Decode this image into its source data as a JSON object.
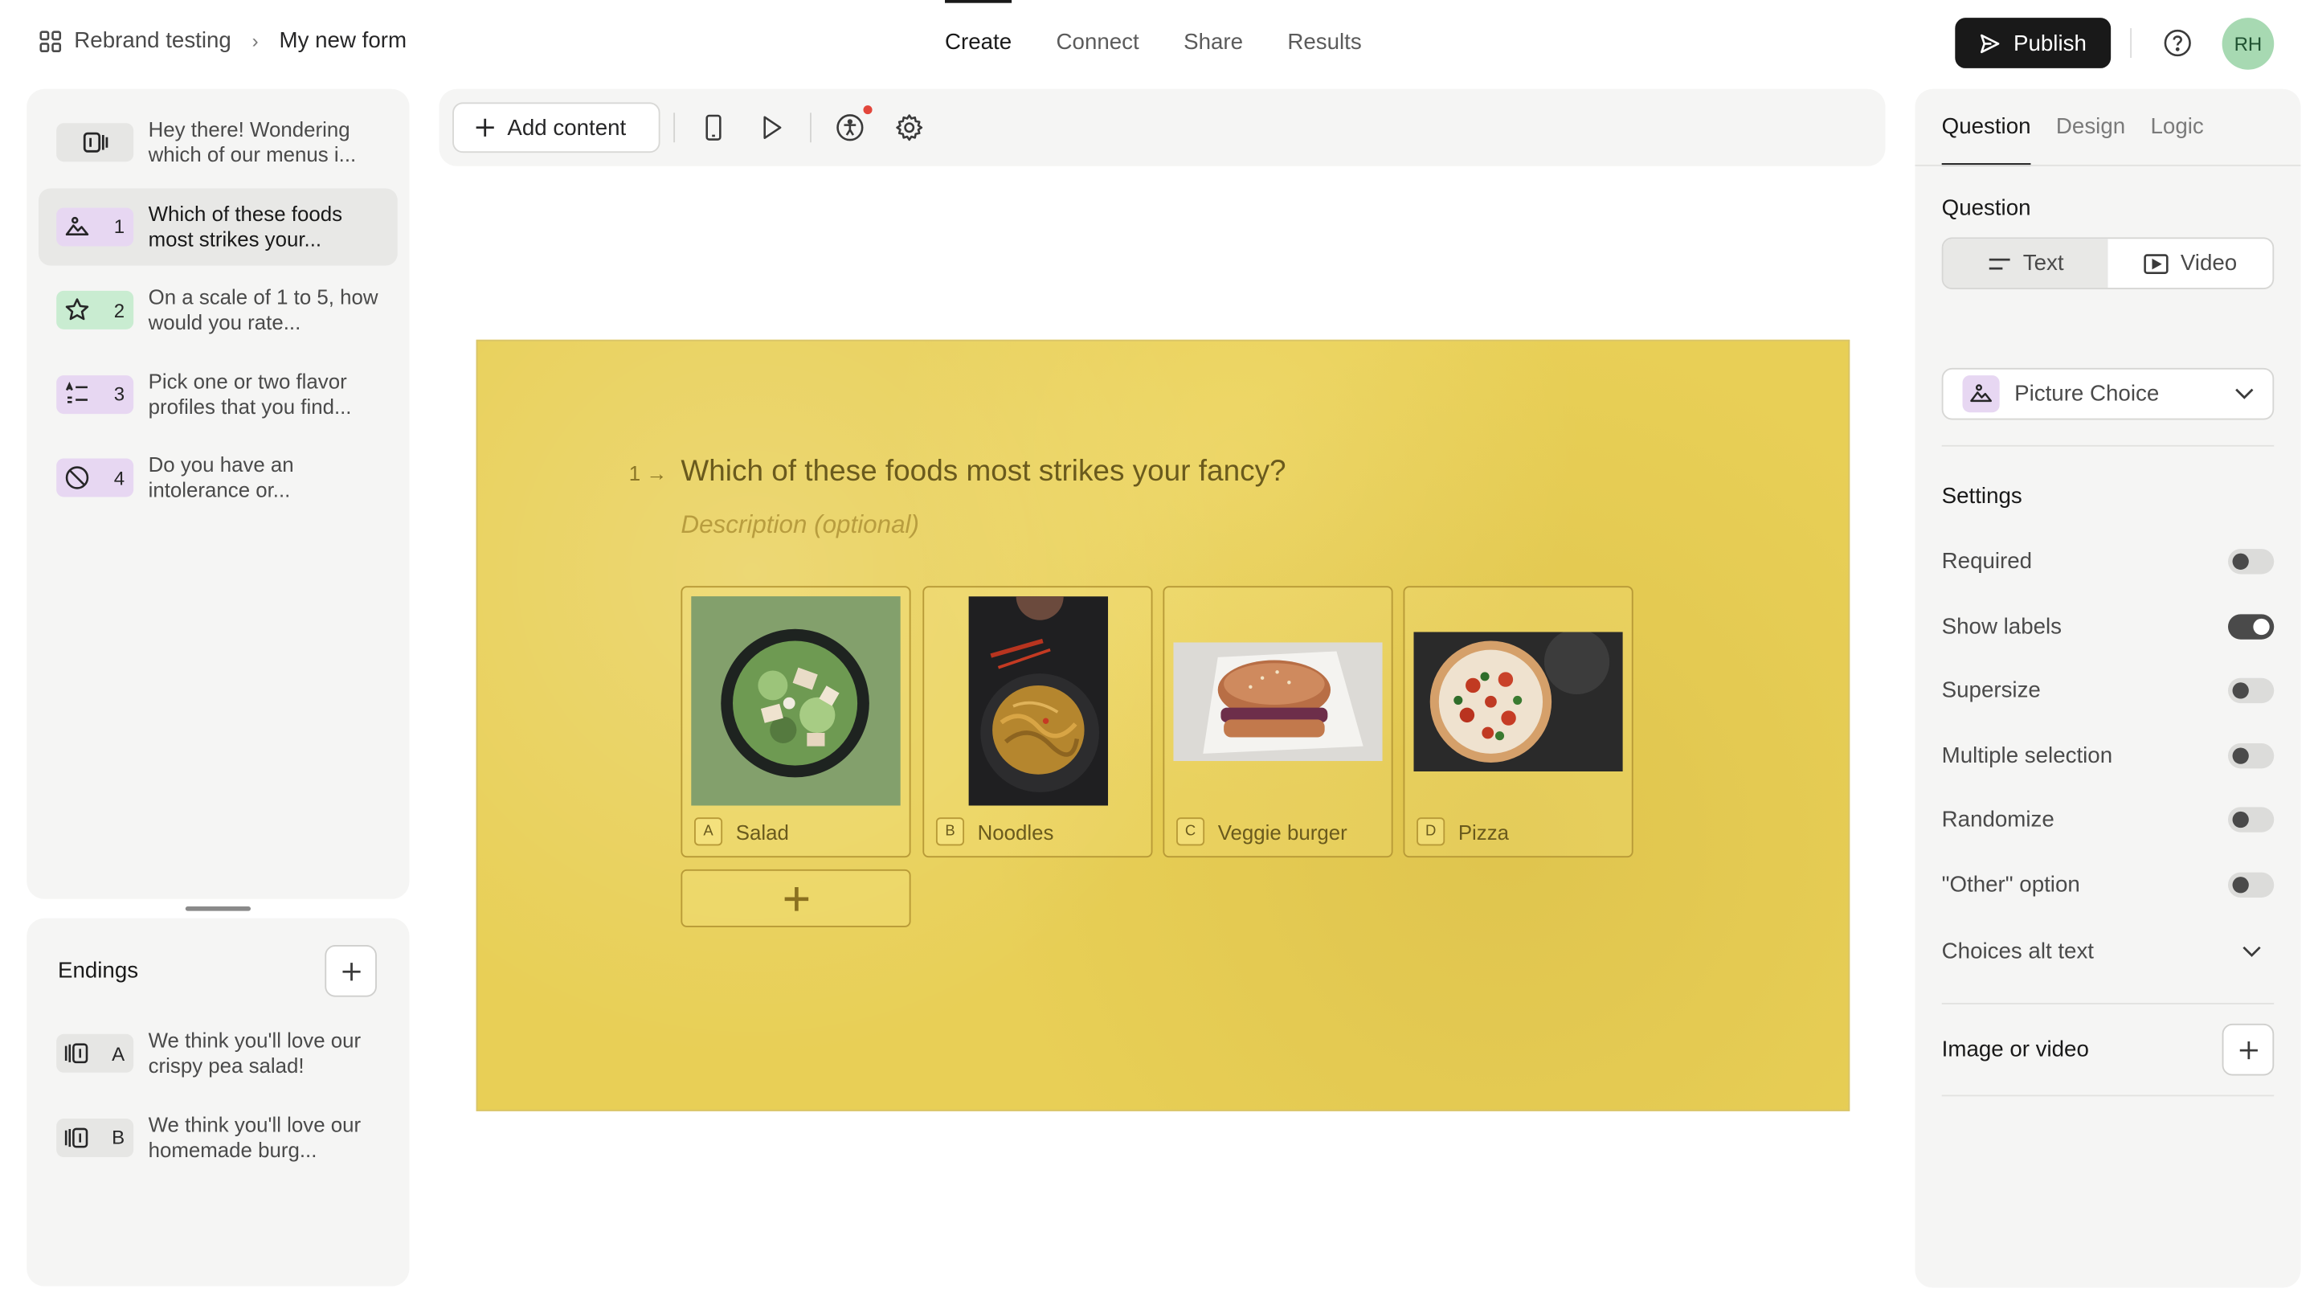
{
  "breadcrumb": {
    "workspace": "Rebrand testing",
    "form": "My new form"
  },
  "nav": {
    "tabs": [
      "Create",
      "Connect",
      "Share",
      "Results"
    ],
    "active": "Create"
  },
  "header": {
    "publish_label": "Publish",
    "avatar_initials": "RH"
  },
  "questions": [
    {
      "num": "",
      "text": "Hey there! Wondering which of our menus i...",
      "icon": "welcome-screen-icon",
      "color": "#e6e6e4"
    },
    {
      "num": "1",
      "text": "Which of these foods most strikes your...",
      "icon": "picture-choice-icon",
      "color": "#e7d7f2"
    },
    {
      "num": "2",
      "text": "On a scale of 1 to 5, how would you rate...",
      "icon": "star-icon",
      "color": "#c9ecd1"
    },
    {
      "num": "3",
      "text": "Pick one or two flavor profiles that you find...",
      "icon": "multiple-choice-icon",
      "color": "#e7d7f2"
    },
    {
      "num": "4",
      "text": "Do you have an intolerance or...",
      "icon": "ban-icon",
      "color": "#e7d7f2"
    }
  ],
  "endings": {
    "title": "Endings",
    "items": [
      {
        "key": "A",
        "text": "We think you'll love our crispy pea salad!"
      },
      {
        "key": "B",
        "text": "We think you'll love our homemade burg..."
      }
    ]
  },
  "toolbar": {
    "add_content": "Add content"
  },
  "canvas": {
    "number": "1",
    "question": "Which of these foods most strikes your fancy?",
    "description_placeholder": "Description (optional)",
    "choices": [
      {
        "key": "A",
        "label": "Salad",
        "image": "salad-bowl"
      },
      {
        "key": "B",
        "label": "Noodles",
        "image": "noodles-plate"
      },
      {
        "key": "C",
        "label": "Veggie burger",
        "image": "veggie-burger"
      },
      {
        "key": "D",
        "label": "Pizza",
        "image": "pizza"
      }
    ],
    "background_color": "#e8cf56"
  },
  "right": {
    "tabs": [
      "Question",
      "Design",
      "Logic"
    ],
    "active_tab": "Question",
    "question_label": "Question",
    "format": {
      "text": "Text",
      "video": "Video",
      "selected": "Text"
    },
    "type": "Picture Choice",
    "settings_label": "Settings",
    "settings": [
      {
        "label": "Required",
        "on": false
      },
      {
        "label": "Show labels",
        "on": true
      },
      {
        "label": "Supersize",
        "on": false
      },
      {
        "label": "Multiple selection",
        "on": false
      },
      {
        "label": "Randomize",
        "on": false
      },
      {
        "label": "\"Other\" option",
        "on": false
      }
    ],
    "alt_text": "Choices alt text",
    "image_or_video": "Image or video"
  }
}
